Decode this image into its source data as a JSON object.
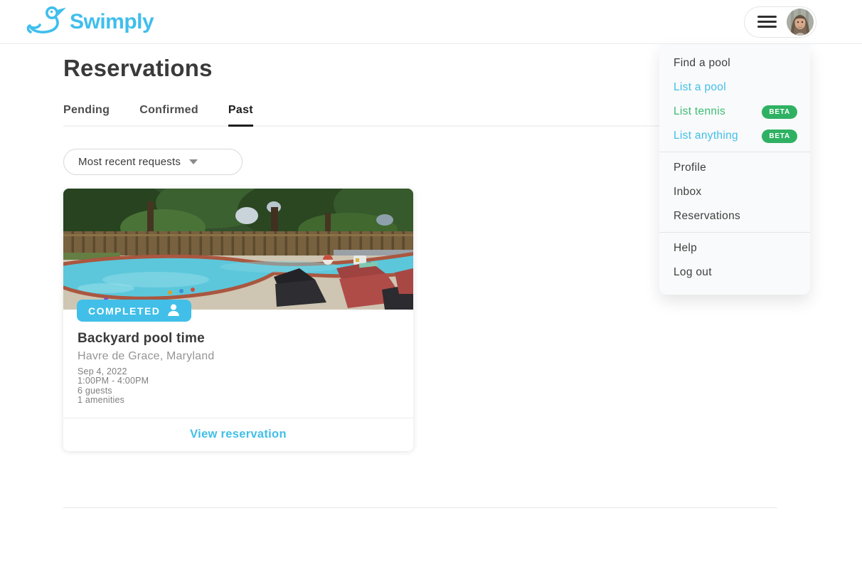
{
  "brand": {
    "name": "Swimply"
  },
  "header": {
    "menu_button": {
      "hamburger_icon": "hamburger-icon",
      "avatar": "user-avatar-photo"
    }
  },
  "menu": {
    "sections": [
      {
        "items": [
          {
            "label": "Find a pool"
          },
          {
            "label": "List a pool"
          },
          {
            "label": "List tennis",
            "badge": "BETA"
          },
          {
            "label": "List anything",
            "badge": "BETA"
          }
        ]
      },
      {
        "items": [
          {
            "label": "Profile"
          },
          {
            "label": "Inbox"
          },
          {
            "label": "Reservations"
          }
        ]
      },
      {
        "items": [
          {
            "label": "Help"
          },
          {
            "label": "Log out"
          }
        ]
      }
    ]
  },
  "page": {
    "title": "Reservations",
    "tabs": [
      {
        "label": "Pending",
        "active": false
      },
      {
        "label": "Confirmed",
        "active": false
      },
      {
        "label": "Past",
        "active": true
      }
    ],
    "sort_value": "Most recent requests"
  },
  "reservation_card": {
    "status": "COMPLETED",
    "status_icon": "person-icon",
    "image_alt": "backyard-pool-photo",
    "title": "Backyard pool time",
    "location": "Havre de Grace, Maryland",
    "date": "Sep 4, 2022",
    "time": "1:00PM - 4:00PM",
    "guests": "6 guests",
    "amenities": "1 amenities",
    "action": "View reservation"
  },
  "colors": {
    "brand_cyan": "#41bfe8",
    "logo_cyan": "#3fbeec",
    "menu_green": "#3dbd72",
    "beta_badge_green": "#2fb163",
    "text_dark": "#3b3b3b",
    "text_gray": "#8e8e8e",
    "active_tab_underline": "#1d1d1d"
  }
}
